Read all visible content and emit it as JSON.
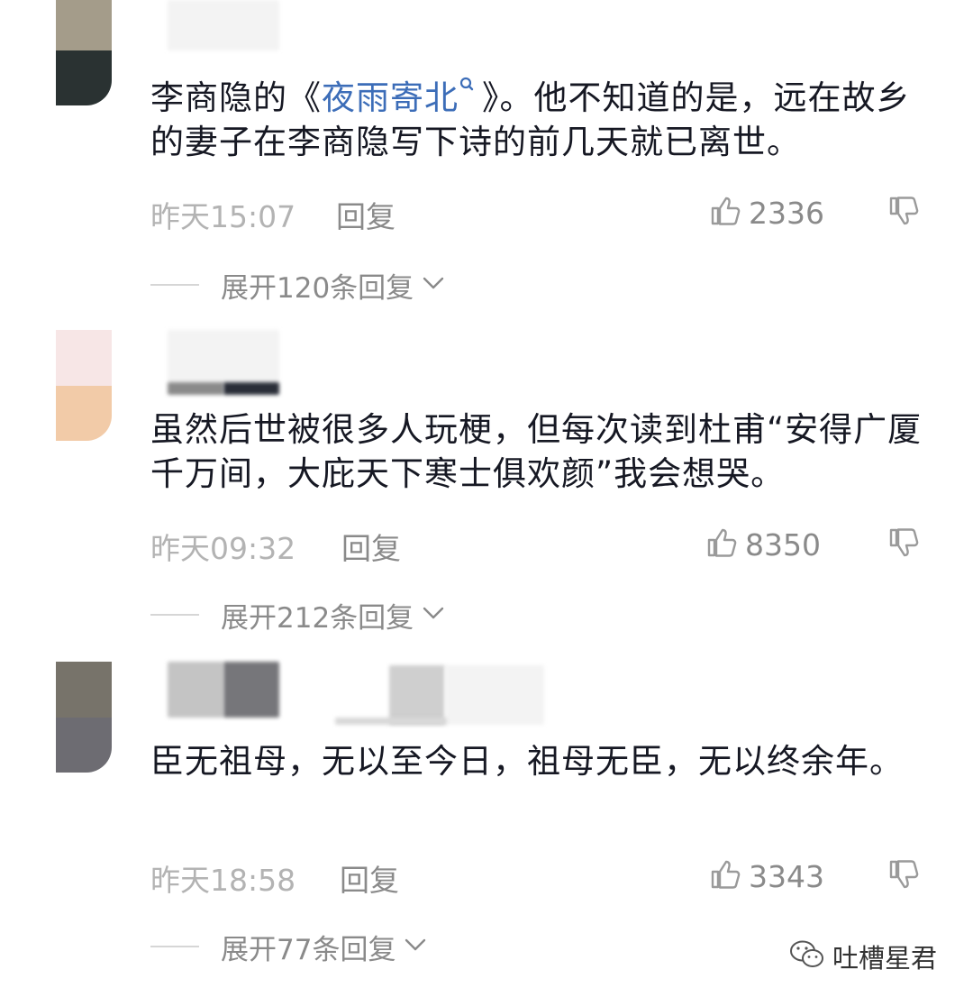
{
  "comments": [
    {
      "text_before": "李商隐的《",
      "link": "夜雨寄北",
      "text_after": "》。他不知道的是，远在故乡的妻子在李商隐写下诗的前几天就已离世。",
      "time": "昨天15:07",
      "reply": "回复",
      "likes": "2336",
      "expand": "展开120条回复",
      "avatar_colors": [
        "#a49c8a",
        "#2a3232"
      ]
    },
    {
      "text": "虽然后世被很多人玩梗，但每次读到杜甫“安得广厦千万间，大庇天下寒士俱欢颜”我会想哭。",
      "time": "昨天09:32",
      "reply": "回复",
      "likes": "8350",
      "expand": "展开212条回复",
      "avatar_colors": [
        "#f7e6e6",
        "#f2cba8"
      ]
    },
    {
      "text": "臣无祖母，无以至今日，祖母无臣，无以终余年。",
      "time": "昨天18:58",
      "reply": "回复",
      "likes": "3343",
      "expand": "展开77条回复",
      "avatar_colors": [
        "#77736a",
        "#6d6c72"
      ]
    }
  ],
  "watermark": "吐槽星君",
  "icons": {
    "like": "thumbs-up-icon",
    "dislike": "thumbs-down-icon",
    "expand": "chevron-down-icon",
    "search": "search-icon",
    "watermark": "wechat-icon"
  }
}
